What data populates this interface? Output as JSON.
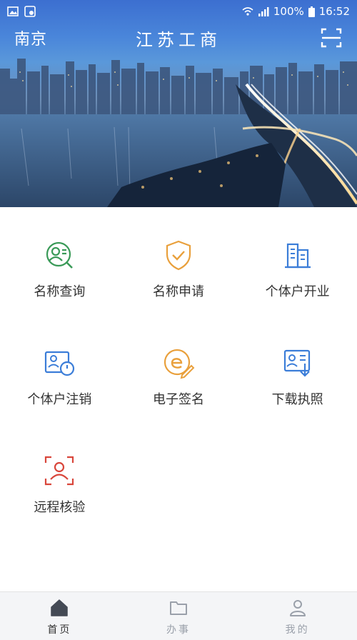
{
  "status_bar": {
    "battery": "100%",
    "time": "16:52"
  },
  "header": {
    "city": "南京",
    "title": "江苏工商"
  },
  "colors": {
    "green": "#3a9a58",
    "orange": "#e9a03c",
    "blue": "#3b7dd8",
    "red": "#d9463b",
    "tab_active": "#444a55",
    "tab_inactive": "#9aa0aa"
  },
  "functions": [
    {
      "label": "名称查询",
      "icon": "name-search-icon"
    },
    {
      "label": "名称申请",
      "icon": "shield-check-icon"
    },
    {
      "label": "个体户开业",
      "icon": "buildings-icon"
    },
    {
      "label": "个体户注销",
      "icon": "deregister-icon"
    },
    {
      "label": "电子签名",
      "icon": "e-sign-icon"
    },
    {
      "label": "下载执照",
      "icon": "download-license-icon"
    },
    {
      "label": "远程核验",
      "icon": "face-verify-icon"
    }
  ],
  "tabs": [
    {
      "label": "首页",
      "icon": "home-icon",
      "active": true
    },
    {
      "label": "办事",
      "icon": "folder-icon",
      "active": false
    },
    {
      "label": "我的",
      "icon": "user-icon",
      "active": false
    }
  ]
}
